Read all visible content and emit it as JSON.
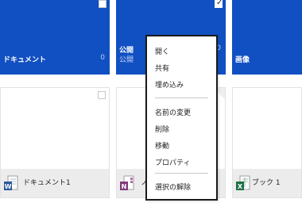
{
  "tiles": [
    {
      "title": "ドキュメント",
      "count": "0"
    },
    {
      "title": "公開",
      "subtitle": "公開",
      "count": "0",
      "checked": true
    },
    {
      "title": "画像"
    }
  ],
  "files": [
    {
      "name": "ドキュメント1",
      "app_icon": "word-icon"
    },
    {
      "name": "ノ",
      "app_icon": "onenote-icon"
    },
    {
      "name": "ブック 1",
      "app_icon": "excel-icon"
    }
  ],
  "context_menu": {
    "items": [
      "開く",
      "共有",
      "埋め込み",
      "名前の変更",
      "削除",
      "移動",
      "プロパティ",
      "選択の解除"
    ]
  },
  "colors": {
    "tile_blue": "#1150c2",
    "word": "#2b5797",
    "onenote": "#80397b",
    "excel": "#1e7145"
  }
}
